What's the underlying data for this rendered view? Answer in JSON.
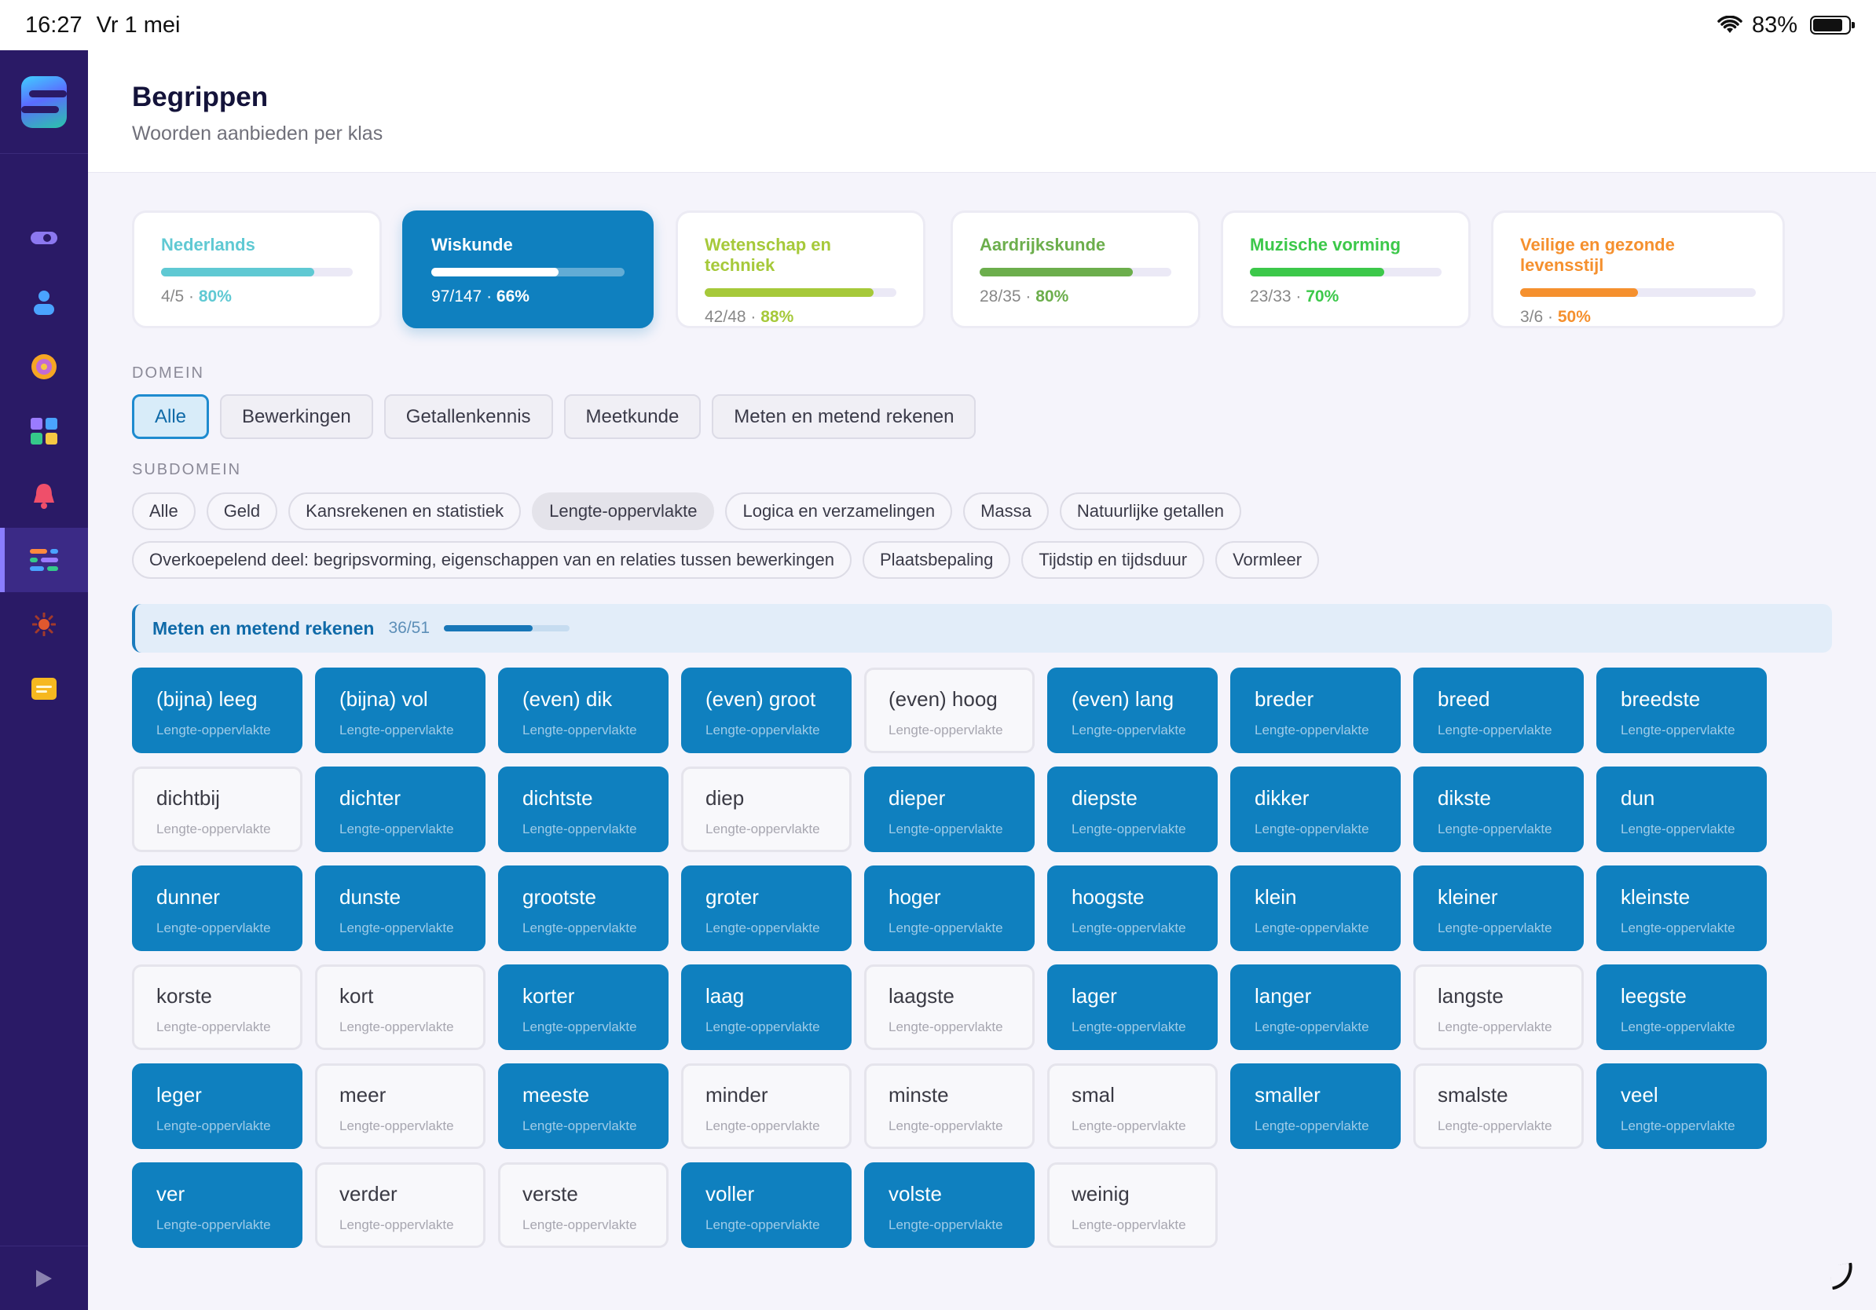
{
  "status": {
    "time": "16:27",
    "date": "Vr 1 mei",
    "battery": "83%",
    "battery_level": 0.83
  },
  "header": {
    "title": "Begrippen",
    "subtitle": "Woorden aanbieden per klas"
  },
  "subjects": [
    {
      "name": "Nederlands",
      "count": "4/5",
      "pct": "80%",
      "progress": 0.8,
      "color": "#5fc9d3",
      "active": false
    },
    {
      "name": "Wiskunde",
      "count": "97/147",
      "pct": "66%",
      "progress": 0.66,
      "color": "#ffffff",
      "active": true
    },
    {
      "name": "Wetenschap en techniek",
      "count": "42/48",
      "pct": "88%",
      "progress": 0.88,
      "color": "#a6c93a",
      "active": false
    },
    {
      "name": "Aardrijkskunde",
      "count": "28/35",
      "pct": "80%",
      "progress": 0.8,
      "color": "#6cae4c",
      "active": false
    },
    {
      "name": "Muzische vorming",
      "count": "23/33",
      "pct": "70%",
      "progress": 0.7,
      "color": "#3cc84a",
      "active": false
    },
    {
      "name": "Veilige en gezonde levensstijl",
      "count": "3/6",
      "pct": "50%",
      "progress": 0.5,
      "color": "#f5902e",
      "active": false
    }
  ],
  "domein": {
    "label": "DOMEIN",
    "items": [
      "Alle",
      "Bewerkingen",
      "Getallenkennis",
      "Meetkunde",
      "Meten en metend rekenen"
    ],
    "active": "Alle"
  },
  "subdomein": {
    "label": "SUBDOMEIN",
    "row1": [
      "Alle",
      "Geld",
      "Kansrekenen en statistiek",
      "Lengte-oppervlakte",
      "Logica en verzamelingen",
      "Massa",
      "Natuurlijke getallen"
    ],
    "row2": [
      "Overkoepelend deel: begripsvorming, eigenschappen van en relaties tussen bewerkingen",
      "Plaatsbepaling",
      "Tijdstip en tijdsduur",
      "Vormleer"
    ],
    "active": "Lengte-oppervlakte"
  },
  "group": {
    "name": "Meten en metend rekenen",
    "count": "36/51",
    "progress": 0.706
  },
  "words": [
    {
      "w": "(bijna) leeg",
      "on": true
    },
    {
      "w": "(bijna) vol",
      "on": true
    },
    {
      "w": "(even) dik",
      "on": true
    },
    {
      "w": "(even) groot",
      "on": true
    },
    {
      "w": "(even) hoog",
      "on": false
    },
    {
      "w": "(even) lang",
      "on": true
    },
    {
      "w": "breder",
      "on": true
    },
    {
      "w": "breed",
      "on": true
    },
    {
      "w": "breedste",
      "on": true
    },
    {
      "w": "dichtbij",
      "on": false
    },
    {
      "w": "dichter",
      "on": true
    },
    {
      "w": "dichtste",
      "on": true
    },
    {
      "w": "diep",
      "on": false
    },
    {
      "w": "dieper",
      "on": true
    },
    {
      "w": "diepste",
      "on": true
    },
    {
      "w": "dikker",
      "on": true
    },
    {
      "w": "dikste",
      "on": true
    },
    {
      "w": "dun",
      "on": true
    },
    {
      "w": "dunner",
      "on": true
    },
    {
      "w": "dunste",
      "on": true
    },
    {
      "w": "grootste",
      "on": true
    },
    {
      "w": "groter",
      "on": true
    },
    {
      "w": "hoger",
      "on": true
    },
    {
      "w": "hoogste",
      "on": true
    },
    {
      "w": "klein",
      "on": true
    },
    {
      "w": "kleiner",
      "on": true
    },
    {
      "w": "kleinste",
      "on": true
    },
    {
      "w": "korste",
      "on": false
    },
    {
      "w": "kort",
      "on": false
    },
    {
      "w": "korter",
      "on": true
    },
    {
      "w": "laag",
      "on": true
    },
    {
      "w": "laagste",
      "on": false
    },
    {
      "w": "lager",
      "on": true
    },
    {
      "w": "langer",
      "on": true
    },
    {
      "w": "langste",
      "on": false
    },
    {
      "w": "leegste",
      "on": true
    },
    {
      "w": "leger",
      "on": true
    },
    {
      "w": "meer",
      "on": false
    },
    {
      "w": "meeste",
      "on": true
    },
    {
      "w": "minder",
      "on": false
    },
    {
      "w": "minste",
      "on": false
    },
    {
      "w": "smal",
      "on": false
    },
    {
      "w": "smaller",
      "on": true
    },
    {
      "w": "smalste",
      "on": false
    },
    {
      "w": "veel",
      "on": true
    },
    {
      "w": "ver",
      "on": true
    },
    {
      "w": "verder",
      "on": false
    },
    {
      "w": "verste",
      "on": false
    },
    {
      "w": "voller",
      "on": true
    },
    {
      "w": "volste",
      "on": true
    },
    {
      "w": "weinig",
      "on": false
    }
  ],
  "word_domain_label": "Lengte-oppervlakte",
  "sidebar_icons": [
    "toggle-icon",
    "user-icon",
    "target-icon",
    "grid-icon",
    "bell-icon",
    "sliders-icon",
    "sun-icon",
    "card-icon"
  ],
  "colors": {
    "primary": "#0f80bf",
    "sidebar": "#2a1a66"
  }
}
